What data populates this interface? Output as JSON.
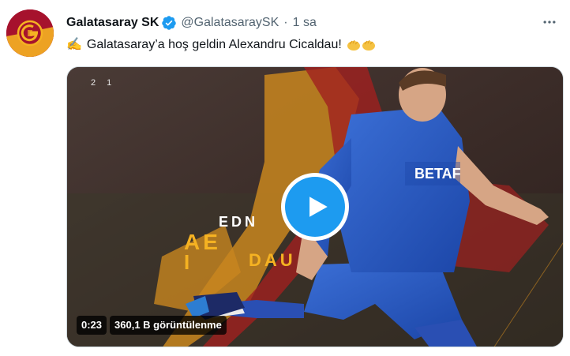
{
  "tweet": {
    "display_name": "Galatasaray SK",
    "handle": "@GalatasaraySK",
    "separator": "·",
    "time": "1 sa",
    "text": "Galatasaray’a hoş geldin Alexandru Cicaldau!",
    "emoji_start": "✍️",
    "verified_icon": "verified-badge-icon",
    "colors": {
      "accent": "#1d9bf0",
      "club_red": "#a6122d",
      "club_yellow": "#f5b222"
    }
  },
  "media": {
    "corner_text": "21",
    "overlay_letters_top": "EDN",
    "overlay_letters_mid": "AE",
    "overlay_letters_bot": "I",
    "overlay_letters_dau": "DAU",
    "duration": "0:23",
    "views": "360,1 B görüntülenme",
    "sponsor_text": "BETAF"
  }
}
